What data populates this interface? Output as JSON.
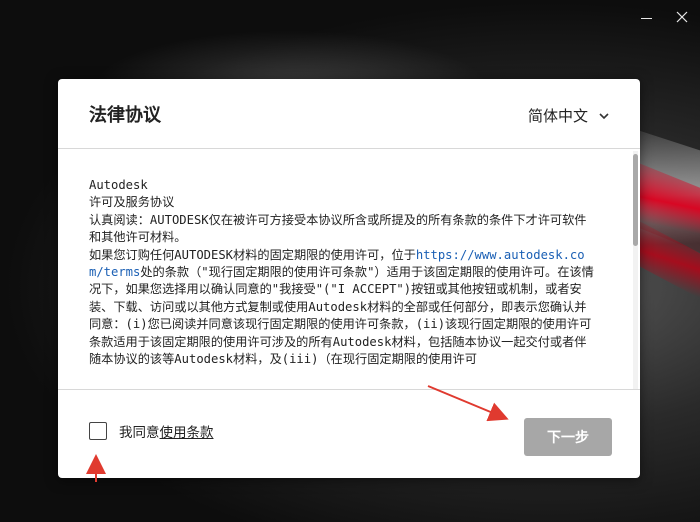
{
  "window": {
    "controls": {
      "minimize_icon": "minimize-icon",
      "close_icon": "close-icon"
    }
  },
  "dialog": {
    "title": "法律协议",
    "language": {
      "selected": "简体中文",
      "icon": "chevron-down-icon"
    },
    "agreement": {
      "line1": "Autodesk",
      "line2": "许可及服务协议",
      "para1": "认真阅读：AUTODESK仅在被许可方接受本协议所含或所提及的所有条款的条件下才许可软件和其他许可材料。",
      "para2_before_link": "如果您订购任何AUTODESK材料的固定期限的使用许可，位于",
      "para2_link": "https://www.autodesk.com/terms",
      "para2_after_link": "处的条款（\"现行固定期限的使用许可条款\"）适用于该固定期限的使用许可。在该情况下，如果您选择用以确认同意的\"我接受\"(\"I ACCEPT\")按钮或其他按钮或机制，或者安装、下载、访问或以其他方式复制或使用Autodesk材料的全部或任何部分，即表示您确认并同意：(i)您已阅读并同意该现行固定期限的使用许可条款，(ii)该现行固定期限的使用许可条款适用于该固定期限的使用许可涉及的所有Autodesk材料，包括随本协议一起交付或者伴随本协议的该等Autodesk材料，及(iii)（在现行固定期限的使用许可"
    },
    "consent": {
      "prefix": "我同意",
      "link": "使用条款"
    },
    "next_button": "下一步"
  },
  "colors": {
    "accent_arrow": "#e03a2f",
    "button_disabled": "#a7a7a7",
    "link": "#1a5fb4"
  }
}
